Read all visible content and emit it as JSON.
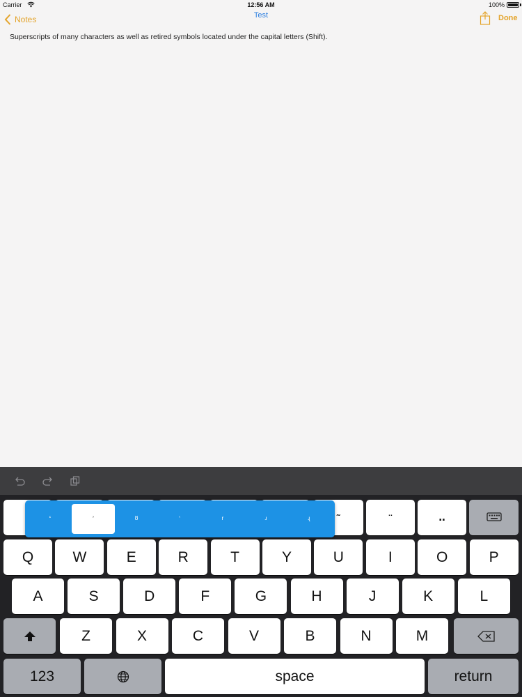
{
  "status_bar": {
    "carrier": "Carrier",
    "time": "12:56 AM",
    "battery": "100%"
  },
  "nav": {
    "back_label": "Notes",
    "title": "Test",
    "done_label": "Done",
    "accent_color": "#e4a42b",
    "title_color": "#2d7fe0"
  },
  "note": {
    "text": "Superscripts of many characters as well as retired symbols located under the capital letters (Shift)."
  },
  "toolbar": {
    "icons": [
      "undo-icon",
      "redo-icon",
      "paste-icon"
    ]
  },
  "keyboard": {
    "alt_popup": {
      "chars": [
        "ʻ",
        "ʾ",
        "ᴽ",
        "ʿ",
        "ʳ",
        "ʴ",
        "ʵ"
      ],
      "selected_index": 1,
      "color": "#1d92e5"
    },
    "row0": [
      "¨",
      "˛",
      "˜",
      "¨",
      "‥"
    ],
    "row1": [
      "Q",
      "W",
      "E",
      "R",
      "T",
      "Y",
      "U",
      "I",
      "O",
      "P"
    ],
    "row2": [
      "A",
      "S",
      "D",
      "F",
      "G",
      "H",
      "J",
      "K",
      "L"
    ],
    "row3": [
      "Z",
      "X",
      "C",
      "V",
      "B",
      "N",
      "M"
    ],
    "numbers_label": "123",
    "space_label": "space",
    "return_label": "return"
  }
}
